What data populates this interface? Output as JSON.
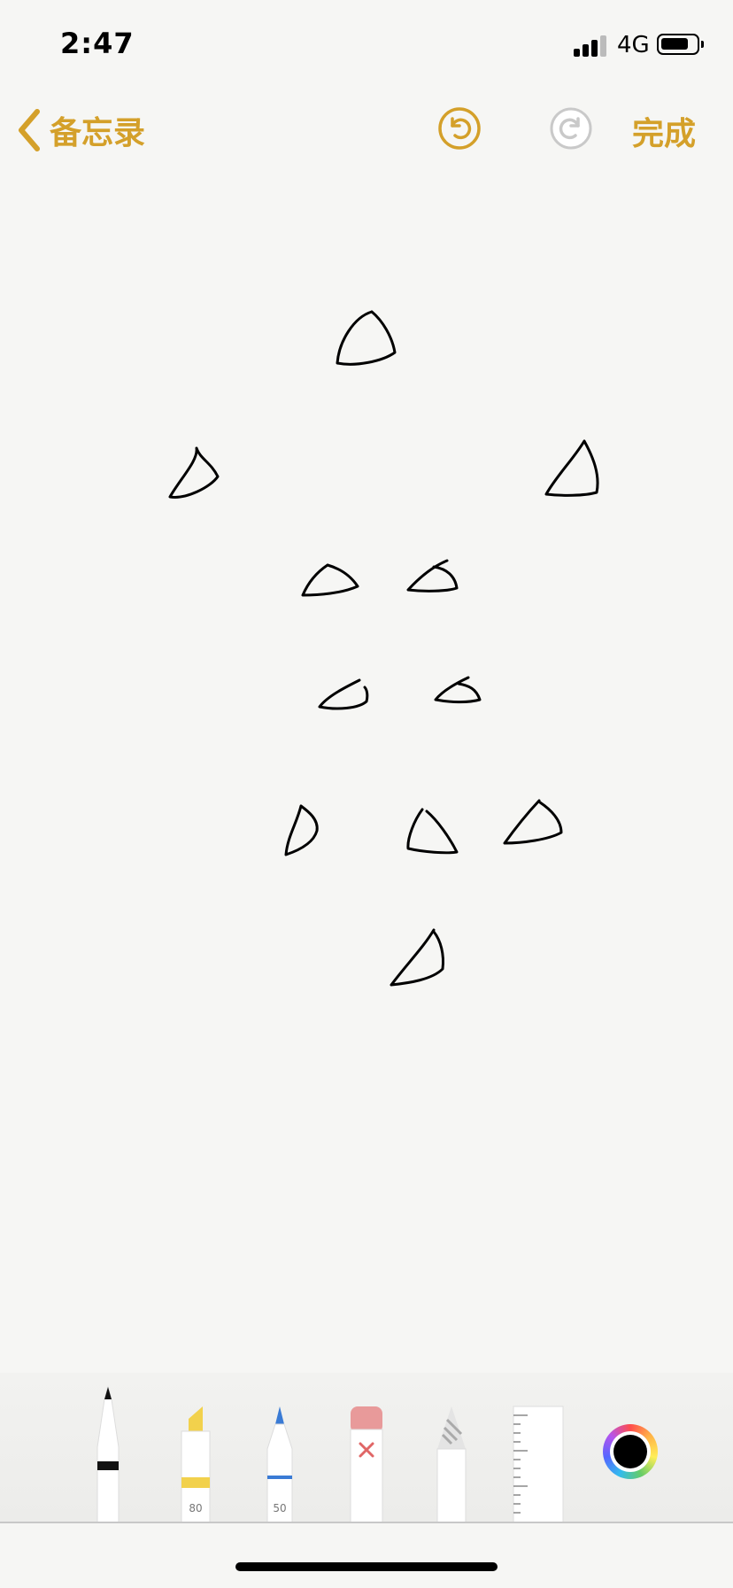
{
  "status_bar": {
    "time": "2:47",
    "network": "4G",
    "signal_bars": 4,
    "battery_level": 0.75
  },
  "nav": {
    "back_label": "备忘录",
    "done_label": "完成",
    "icons": {
      "back": "chevron-left-icon",
      "undo": "undo-icon",
      "redo": "redo-icon"
    },
    "undo_enabled": true,
    "redo_enabled": false,
    "accent_color": "#d4a02a"
  },
  "canvas": {
    "background_color": "#f6f6f4",
    "ink_color": "#000000",
    "stroke_count": 13
  },
  "toolbar": {
    "tools": [
      {
        "name": "pen",
        "label": ""
      },
      {
        "name": "marker",
        "label": "80"
      },
      {
        "name": "pencil",
        "label": "50"
      },
      {
        "name": "eraser",
        "label": ""
      },
      {
        "name": "lasso",
        "label": ""
      },
      {
        "name": "ruler",
        "label": ""
      }
    ],
    "selected_color": "#000000"
  }
}
